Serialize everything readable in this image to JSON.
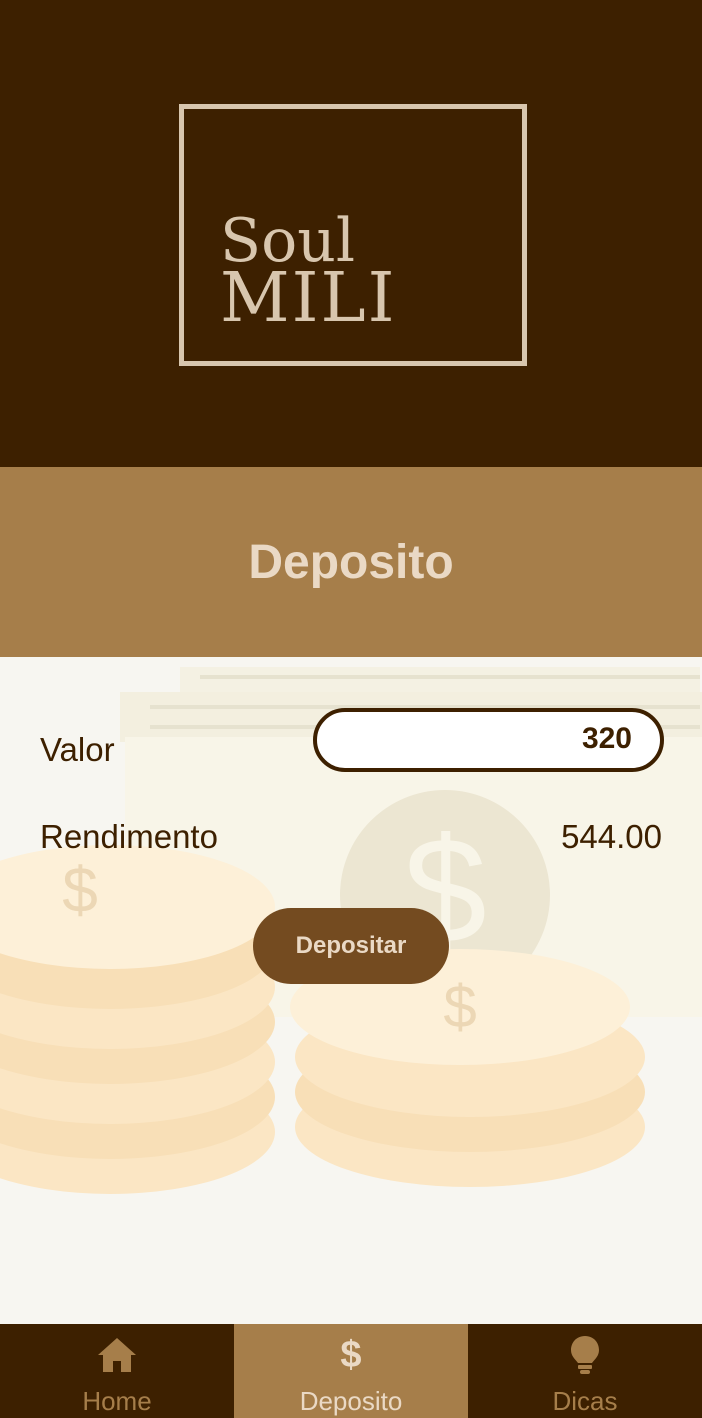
{
  "app": {
    "logo_line1": "Soul",
    "logo_line2": "MILI"
  },
  "page": {
    "title": "Deposito"
  },
  "form": {
    "valor_label": "Valor",
    "valor_value": "320",
    "rendimento_label": "Rendimento",
    "rendimento_value": "544.00",
    "submit_label": "Depositar"
  },
  "nav": {
    "items": [
      {
        "label": "Home",
        "icon": "home-icon",
        "active": false
      },
      {
        "label": "Deposito",
        "icon": "dollar-icon",
        "active": true
      },
      {
        "label": "Dicas",
        "icon": "lightbulb-icon",
        "active": false
      }
    ]
  },
  "colors": {
    "header_bg": "#3d2000",
    "accent": "#a67e4a",
    "button": "#744b20",
    "text_light": "#ead9c5"
  }
}
